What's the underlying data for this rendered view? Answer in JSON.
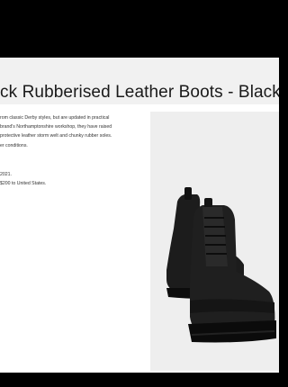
{
  "product": {
    "title": "ck Rubberised Leather Boots - Black",
    "description_lines": [
      "rom classic Derby styles, but are updated in practical",
      "brand's Northamptonshire workshop, they have raised",
      "protective leather storm welt and chunky rubber soles.",
      "er conditions."
    ],
    "meta_lines": [
      "2021.",
      "$200 to United States."
    ],
    "image_label": "black-rubberised-leather-boots"
  },
  "colors": {
    "background": "#000000",
    "page": "#ffffff",
    "title_bar": "#f1f1f1",
    "photo_bg": "#eeeeee",
    "boot": "#1c1c1c"
  }
}
